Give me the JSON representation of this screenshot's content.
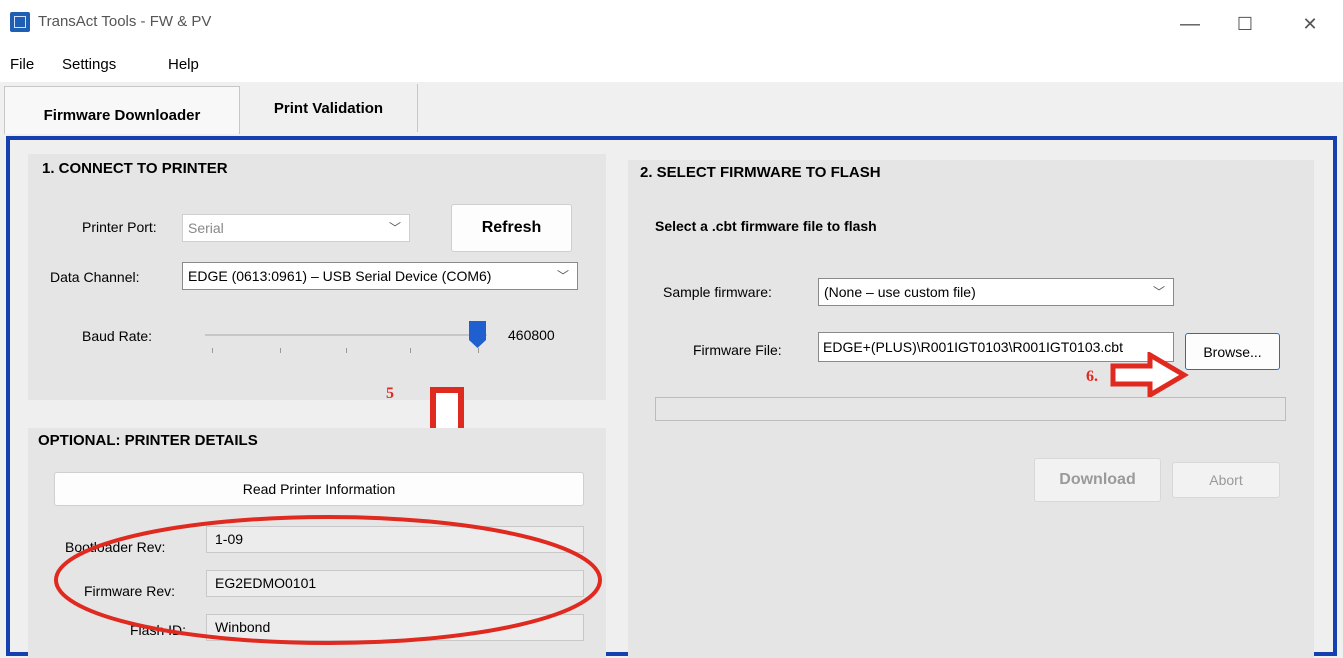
{
  "window": {
    "title": "TransAct Tools - FW & PV",
    "minimize": "—",
    "maximize": "☐",
    "close": "✕"
  },
  "menu": {
    "items": [
      "File",
      "Settings",
      "Help"
    ]
  },
  "tabs": [
    {
      "label": "Firmware Downloader"
    },
    {
      "label": "Print Validation"
    }
  ],
  "connect": {
    "title": "1. CONNECT TO PRINTER",
    "printer_port_label": "Printer Port:",
    "printer_port_value": "Serial",
    "refresh_label": "Refresh",
    "data_channel_label": "Data Channel:",
    "data_channel_value": "EDGE (0613:0961) – USB Serial Device (COM6)",
    "baud_label": "Baud Rate:",
    "baud_value": "460800"
  },
  "details": {
    "title": "OPTIONAL: PRINTER DETAILS",
    "read_button": "Read Printer Information",
    "bootloader_label": "Bootloader Rev:",
    "bootloader_value": "1-09",
    "firmware_label": "Firmware Rev:",
    "firmware_value": "EG2EDMO0101",
    "flash_label": "Flash ID:",
    "flash_value": "Winbond"
  },
  "select": {
    "title": "2. SELECT FIRMWARE TO FLASH",
    "subtitle": "Select a .cbt firmware file to flash",
    "sample_label": "Sample firmware:",
    "sample_value": "(None – use custom file)",
    "file_label": "Firmware File:",
    "file_value": "EDGE+(PLUS)\\R001IGT0103\\R001IGT0103.cbt",
    "browse_label": "Browse...",
    "download_label": "Download",
    "abort_label": "Abort"
  },
  "annotations": {
    "step5": "5",
    "step6": "6.",
    "color": "#e0291f"
  }
}
